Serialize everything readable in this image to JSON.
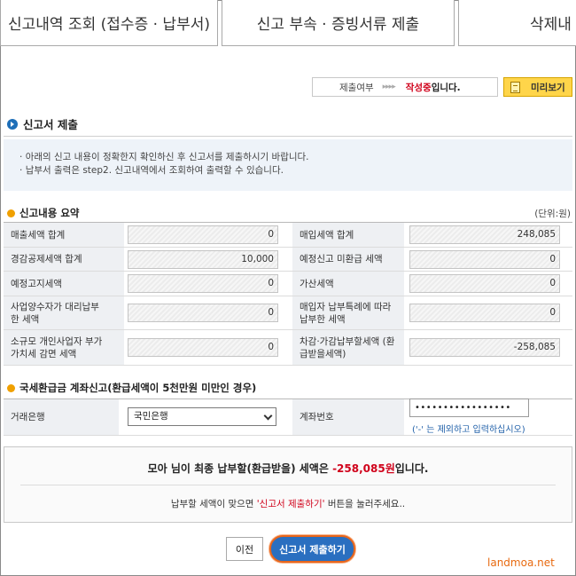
{
  "tabs": [
    {
      "label": "신고내역 조회 (접수증 · 납부서)"
    },
    {
      "label": "신고 부속 · 증빙서류 제출"
    },
    {
      "label": "삭제내"
    }
  ],
  "status": {
    "label": "제출여부",
    "arrows": "▸▸▸▸",
    "state": "작성중",
    "state_suffix": "입니다.",
    "preview_button": "미리보기"
  },
  "section_title": "신고서 제출",
  "notice": [
    "아래의 신고 내용이 정확한지 확인하신 후 신고서를 제출하시기 바랍니다.",
    "납부서 출력은 step2. 신고내역에서 조회하여 출력할 수 있습니다."
  ],
  "summary": {
    "title": "신고내용 요약",
    "unit": "(단위:원)",
    "rows": [
      {
        "left_label": "매출세액 합계",
        "left_value": "0",
        "right_label": "매입세액 합계",
        "right_value": "248,085"
      },
      {
        "left_label": "경감공제세액 합계",
        "left_value": "10,000",
        "right_label": "예정신고 미환급 세액",
        "right_value": "0"
      },
      {
        "left_label": "예정고지세액",
        "left_value": "0",
        "right_label": "가산세액",
        "right_value": "0"
      },
      {
        "left_label": "사업양수자가 대리납부한 세액",
        "left_value": "0",
        "right_label": "매입자 납부특례에 따라 납부한 세액",
        "right_value": "0"
      },
      {
        "left_label": "소규모 개인사업자 부가가치세 감면 세액",
        "left_value": "0",
        "right_label": "차감·가감납부할세액 (환급받을세액)",
        "right_value": "-258,085"
      }
    ]
  },
  "refund": {
    "title": "국세환급금 계좌신고(환급세액이 5천만원 미만인 경우)",
    "bank_label": "거래은행",
    "bank_value": "국민은행",
    "account_label": "계좌번호",
    "account_value": "•••••••••••••••••",
    "account_hint": "('-' 는 제외하고 입력하십시오)"
  },
  "result": {
    "prefix": "모아 님이 최종 납부할(환급받을) 세액은 ",
    "amount": "-258,085원",
    "suffix": "입니다.",
    "guide_prefix": "납부할 세액이 맞으면 ",
    "guide_highlight": "'신고서 제출하기'",
    "guide_suffix": " 버튼을 눌러주세요.."
  },
  "buttons": {
    "prev": "이전",
    "submit": "신고서 제출하기"
  },
  "watermark": "landmoa.net"
}
